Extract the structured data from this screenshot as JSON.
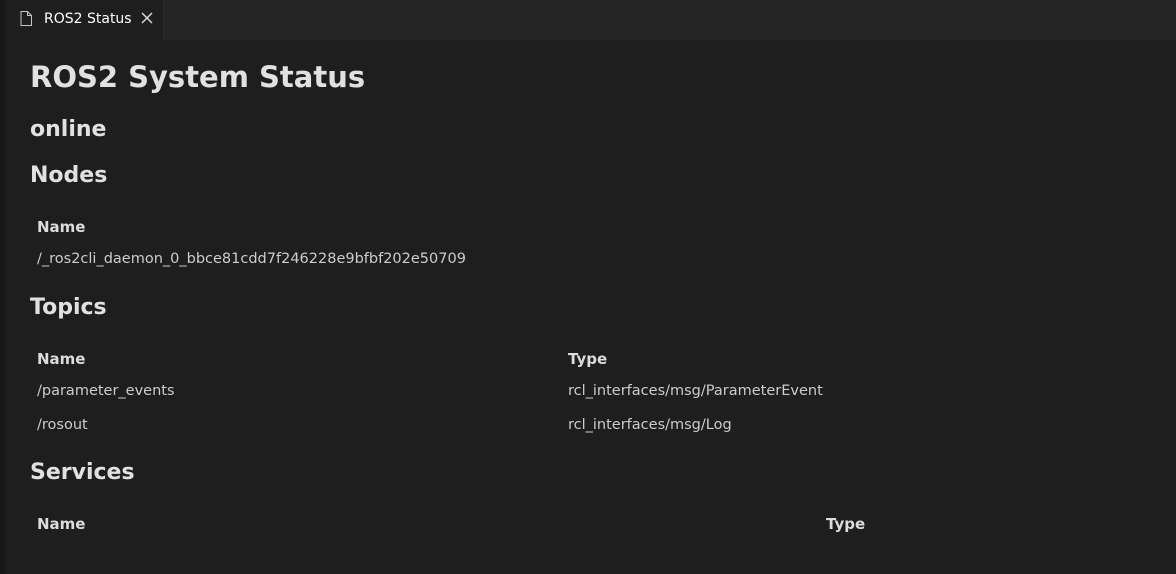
{
  "tab": {
    "title": "ROS2 Status",
    "file_icon": "file-icon",
    "close_icon": "close-icon"
  },
  "page": {
    "title": "ROS2 System Status",
    "status": "online"
  },
  "nodes": {
    "heading": "Nodes",
    "columns": [
      "Name"
    ],
    "rows": [
      [
        "/_ros2cli_daemon_0_bbce81cdd7f246228e9bfbf202e50709"
      ]
    ]
  },
  "topics": {
    "heading": "Topics",
    "columns": [
      "Name",
      "Type"
    ],
    "rows": [
      [
        "/parameter_events",
        "rcl_interfaces/msg/ParameterEvent"
      ],
      [
        "/rosout",
        "rcl_interfaces/msg/Log"
      ]
    ]
  },
  "services": {
    "heading": "Services",
    "columns": [
      "Name",
      "Type"
    ],
    "rows": []
  }
}
